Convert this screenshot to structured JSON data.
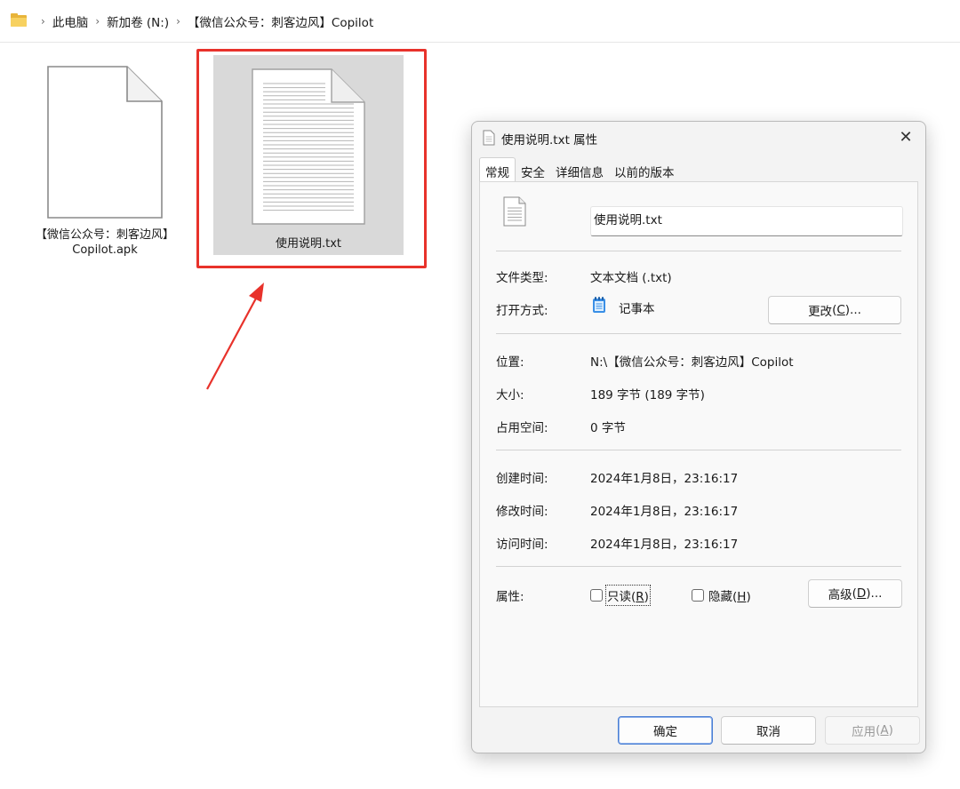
{
  "breadcrumb": {
    "items": [
      "此电脑",
      "新加卷 (N:)",
      "【微信公众号：刺客边风】Copilot"
    ],
    "separator": "›"
  },
  "files": [
    {
      "name_line1": "【微信公众号：刺客边风】",
      "name_line2": "Copilot.apk",
      "icon": "blank-file-icon",
      "selected": false
    },
    {
      "name_line1": "使用说明.txt",
      "icon": "text-file-icon",
      "selected": true
    }
  ],
  "annotation": {
    "highlight_color": "#e8322b"
  },
  "dialog": {
    "title": "使用说明.txt 属性",
    "close_glyph": "✕",
    "tabs": [
      "常规",
      "安全",
      "详细信息",
      "以前的版本"
    ],
    "active_tab": "常规",
    "general": {
      "file_name": "使用说明.txt",
      "rows": {
        "type_label": "文件类型:",
        "type_value": "文本文档 (.txt)",
        "open_with_label": "打开方式:",
        "open_with_value": "记事本",
        "open_with_icon": "notepad-icon",
        "change_button_text": "更改",
        "change_button_key": "C",
        "location_label": "位置:",
        "location_value": "N:\\【微信公众号：刺客边风】Copilot",
        "size_label": "大小:",
        "size_value": "189 字节 (189 字节)",
        "disk_size_label": "占用空间:",
        "disk_size_value": "0 字节",
        "created_label": "创建时间:",
        "created_value": "2024年1月8日，23:16:17",
        "modified_label": "修改时间:",
        "modified_value": "2024年1月8日，23:16:17",
        "accessed_label": "访问时间:",
        "accessed_value": "2024年1月8日，23:16:17",
        "attributes_label": "属性:",
        "readonly_text": "只读",
        "readonly_key": "R",
        "readonly_checked": false,
        "hidden_text": "隐藏",
        "hidden_key": "H",
        "hidden_checked": false,
        "advanced_button_text": "高级",
        "advanced_button_key": "D"
      }
    },
    "buttons": {
      "ok": "确定",
      "cancel": "取消",
      "apply_text": "应用",
      "apply_key": "A",
      "apply_enabled": false
    }
  }
}
